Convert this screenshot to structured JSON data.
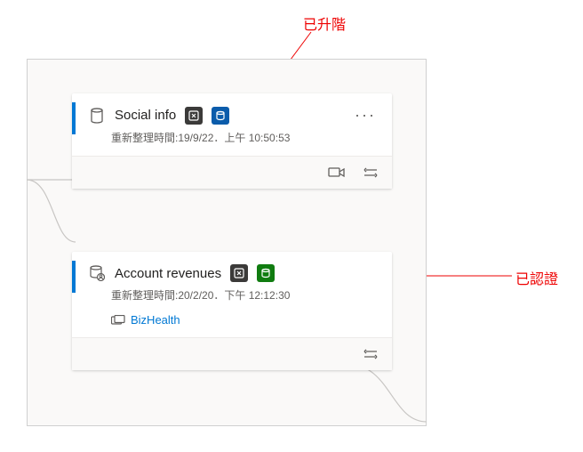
{
  "annotations": {
    "top": "已升階",
    "right": "已認證"
  },
  "cards": [
    {
      "title": "Social info",
      "refresh": "重新整理時間:19/9/22．上午 10:50:53",
      "badges": {
        "promoted": true,
        "certified": false
      },
      "link": null
    },
    {
      "title": "Account revenues",
      "refresh": "重新整理時間:20/2/20．下午 12:12:30",
      "badges": {
        "promoted": false,
        "certified": true
      },
      "link": "BizHealth"
    }
  ]
}
